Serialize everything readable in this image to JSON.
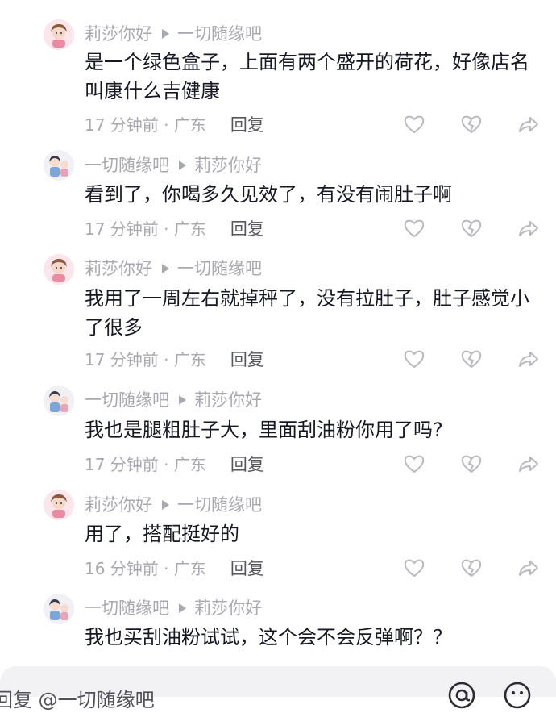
{
  "comments": [
    {
      "author": "莉莎你好",
      "reply_to": "一切随缘吧",
      "text": "是一个绿色盒子，上面有两个盛开的荷花，好像店名叫康什么吉健康",
      "time": "17 分钟前 · 广东",
      "reply_label": "回复",
      "avatar": "avatar-pink"
    },
    {
      "author": "一切随缘吧",
      "reply_to": "莉莎你好",
      "text": "看到了，你喝多久见效了，有没有闹肚子啊",
      "time": "17 分钟前 · 广东",
      "reply_label": "回复",
      "avatar": "avatar-light"
    },
    {
      "author": "莉莎你好",
      "reply_to": "一切随缘吧",
      "text": "我用了一周左右就掉秤了，没有拉肚子，肚子感觉小了很多",
      "time": "17 分钟前 · 广东",
      "reply_label": "回复",
      "avatar": "avatar-pink"
    },
    {
      "author": "一切随缘吧",
      "reply_to": "莉莎你好",
      "text": "我也是腿粗肚子大，里面刮油粉你用了吗?",
      "time": "17 分钟前 · 广东",
      "reply_label": "回复",
      "avatar": "avatar-light"
    },
    {
      "author": "莉莎你好",
      "reply_to": "一切随缘吧",
      "text": "用了，搭配挺好的",
      "time": "16 分钟前 · 广东",
      "reply_label": "回复",
      "avatar": "avatar-pink"
    },
    {
      "author": "一切随缘吧",
      "reply_to": "莉莎你好",
      "text": "我也买刮油粉试试，这个会不会反弹啊？？",
      "time": "",
      "reply_label": "",
      "avatar": "avatar-light"
    }
  ],
  "input": {
    "placeholder": "回复 @一切随缘吧"
  },
  "icons": {
    "like": "heart-icon",
    "dislike": "broken-heart-icon",
    "share": "share-arrow-icon",
    "mention": "at-icon",
    "emoji": "emoji-icon"
  },
  "colors": {
    "text": "#161823",
    "meta": "#a8a9b0",
    "icon": "#b8b9be",
    "bar": "#f2f2f4"
  }
}
